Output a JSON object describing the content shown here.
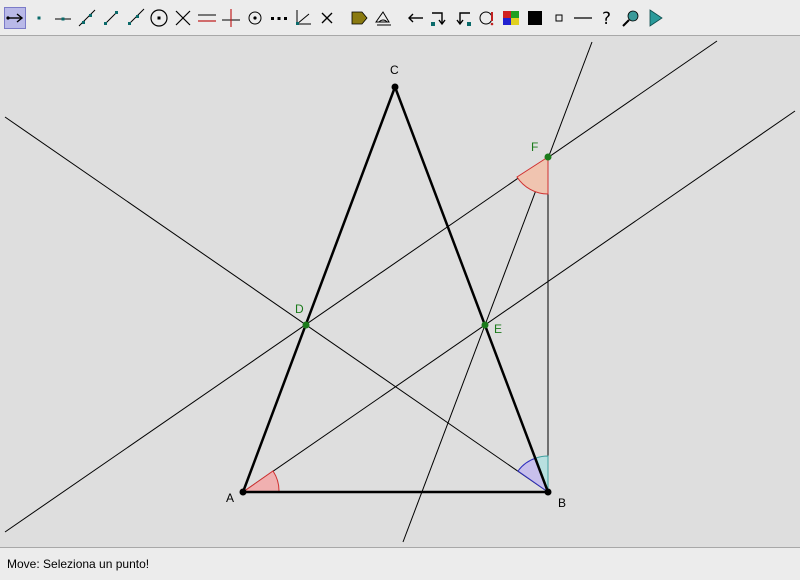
{
  "toolbar": {
    "tools": [
      {
        "name": "move-tool-icon",
        "active": true
      },
      {
        "name": "point-tool-icon"
      },
      {
        "name": "point-on-line-icon"
      },
      {
        "name": "line-tool-icon"
      },
      {
        "name": "segment-tool-icon"
      },
      {
        "name": "ray-tool-icon"
      },
      {
        "name": "circle-tool-icon"
      },
      {
        "name": "intersection-tool-icon"
      },
      {
        "name": "parallel-tool-icon"
      },
      {
        "name": "perpendicular-tool-icon"
      },
      {
        "name": "midpoint-tool-icon"
      },
      {
        "name": "dotted-line-icon"
      },
      {
        "name": "angle-tool-icon"
      },
      {
        "name": "delete-tool-icon"
      },
      {
        "name": "label-tag-icon"
      },
      {
        "name": "measure-tool-icon"
      },
      {
        "name": "undo-arrow-icon"
      },
      {
        "name": "redo-turn-icon"
      },
      {
        "name": "rotate-turn-icon"
      },
      {
        "name": "macro-tool-icon"
      },
      {
        "name": "color-palette-icon"
      },
      {
        "name": "fill-black-icon"
      },
      {
        "name": "point-size-icon"
      },
      {
        "name": "line-style-icon"
      },
      {
        "name": "help-question-icon"
      },
      {
        "name": "zoom-tool-icon"
      },
      {
        "name": "play-arrow-icon"
      }
    ]
  },
  "colors": {
    "background": "#dedede",
    "line": "#000000",
    "point_black": "#000000",
    "point_green": "#1a7a1a",
    "angle_red_fill": "#f0b0b0",
    "angle_red_stroke": "#d03030",
    "angle_blue_stroke": "#3030c0",
    "angle_teal_stroke": "#40a0a0"
  },
  "figure": {
    "points": {
      "A": {
        "label": "A",
        "color": "black"
      },
      "B": {
        "label": "B",
        "color": "black"
      },
      "C": {
        "label": "C",
        "color": "black"
      },
      "D": {
        "label": "D",
        "color": "green"
      },
      "E": {
        "label": "E",
        "color": "green"
      },
      "F": {
        "label": "F",
        "color": "green"
      }
    }
  },
  "status": {
    "message": "Move: Seleziona un punto!"
  }
}
